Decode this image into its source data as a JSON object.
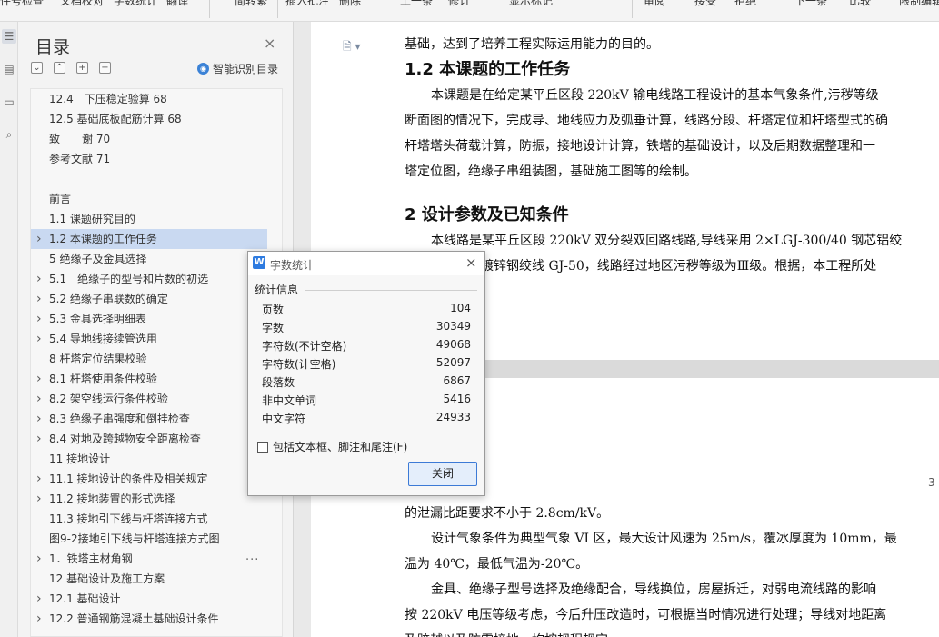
{
  "ribbon": {
    "items": [
      "件号检查",
      "文档校对",
      "字数统计",
      "翻译",
      "简转繁",
      "插入批注",
      "删除",
      "上一条",
      "修订",
      "显示标记",
      "审阅",
      "接受",
      "拒绝",
      "下一条",
      "比较",
      "限制编辑"
    ]
  },
  "sidebar_icons": [
    "toc-icon",
    "pages-icon",
    "bookmark-icon",
    "find-icon"
  ],
  "toc": {
    "title": "目录",
    "close": "×",
    "tools": [
      "⌄",
      "⌃",
      "+",
      "−"
    ],
    "smart_label": "智能识别目录",
    "items": [
      {
        "label": "12.4　下压稳定验算 68",
        "arrow": false,
        "indent": 1
      },
      {
        "label": "12.5 基础底板配筋计算 68",
        "arrow": false,
        "indent": 1
      },
      {
        "label": "致　　谢 70",
        "arrow": false,
        "indent": 1
      },
      {
        "label": "参考文献 71",
        "arrow": false,
        "indent": 1
      },
      {
        "label": "",
        "arrow": false,
        "indent": 1
      },
      {
        "label": "前言",
        "arrow": false,
        "indent": 1
      },
      {
        "label": "1.1  课题研究目的",
        "arrow": false,
        "indent": 1
      },
      {
        "label": "1.2  本课题的工作任务",
        "arrow": true,
        "indent": 1,
        "selected": true
      },
      {
        "label": "5 绝缘子及金具选择",
        "arrow": false,
        "indent": 1
      },
      {
        "label": "5.1　绝缘子的型号和片数的初选",
        "arrow": true,
        "indent": 1
      },
      {
        "label": "5.2 绝缘子串联数的确定",
        "arrow": true,
        "indent": 1
      },
      {
        "label": "5.3 金具选择明细表",
        "arrow": true,
        "indent": 1
      },
      {
        "label": "5.4 导地线接续管选用",
        "arrow": true,
        "indent": 1
      },
      {
        "label": "8 杆塔定位结果校验",
        "arrow": false,
        "indent": 1
      },
      {
        "label": "8.1 杆塔使用条件校验",
        "arrow": true,
        "indent": 1
      },
      {
        "label": "8.2 架空线运行条件校验",
        "arrow": true,
        "indent": 1
      },
      {
        "label": "8.3 绝缘子串强度和倒挂检查",
        "arrow": true,
        "indent": 1
      },
      {
        "label": "8.4 对地及跨越物安全距离检查",
        "arrow": true,
        "indent": 1
      },
      {
        "label": "11 接地设计",
        "arrow": false,
        "indent": 1
      },
      {
        "label": "11.1 接地设计的条件及相关规定",
        "arrow": true,
        "indent": 1
      },
      {
        "label": "11.2 接地装置的形式选择",
        "arrow": true,
        "indent": 1
      },
      {
        "label": "11.3 接地引下线与杆塔连接方式",
        "arrow": false,
        "indent": 1
      },
      {
        "label": "图9-2接地引下线与杆塔连接方式图",
        "arrow": false,
        "indent": 1
      },
      {
        "label": "1．铁塔主材角钢",
        "arrow": true,
        "indent": 1
      },
      {
        "label": "12 基础设计及施工方案",
        "arrow": false,
        "indent": 1
      },
      {
        "label": "12.1 基础设计",
        "arrow": true,
        "indent": 1
      },
      {
        "label": "12.2  普通钢筋混凝土基础设计条件",
        "arrow": true,
        "indent": 1
      }
    ],
    "more": "..."
  },
  "document": {
    "page1_lines": [
      {
        "type": "text",
        "text": "基础，达到了培养工程实际运用能力的目的。"
      },
      {
        "type": "heading",
        "text": "1.2  本课题的工作任务"
      },
      {
        "type": "text",
        "text": "本课题是在给定某平丘区段 220kV 输电线路工程设计的基本气象条件,污秽等级"
      },
      {
        "type": "text",
        "text": "断面图的情况下，完成导、地线应力及弧垂计算，线路分段、杆塔定位和杆塔型式的确"
      },
      {
        "type": "text",
        "text": "杆塔塔头荷载计算，防振，接地设计计算，铁塔的基础设计，以及后期数据整理和一"
      },
      {
        "type": "text",
        "text": "塔定位图，绝缘子串组装图，基础施工图等的绘制。"
      },
      {
        "type": "heading",
        "text": "2   设计参数及已知条件"
      },
      {
        "type": "text",
        "text": "本线路是某平丘区段 220kV 双分裂双回路线路,导线采用 2×LGJ-300/40 钢芯铝绞"
      },
      {
        "type": "text",
        "text": "选配地线采用镀锌钢绞线 GJ-50，线路经过地区污秽等级为Ⅲ级。根据，本工程所处"
      }
    ],
    "page_number": "3",
    "page2_lines": [
      "的泄漏比距要求不小于 2.8cm/kV。",
      "设计气象条件为典型气象 VI 区，最大设计风速为 25m/s，覆冰厚度为 10mm，最",
      "温为 40℃，最低气温为-20℃。",
      "金具、绝缘子型号选择及绝缘配合，导线换位，房屋拆迁，对弱电流线路的影响",
      "按 220kV 电压等级考虑，今后升压改造时，可根据当时情况进行处理；导线对地距离",
      "及跨越以及防雷接地，均按规程规定。"
    ]
  },
  "dialog": {
    "title": "字数统计",
    "close": "×",
    "section_label": "统计信息",
    "stats": [
      {
        "label": "页数",
        "value": "104"
      },
      {
        "label": "字数",
        "value": "30349"
      },
      {
        "label": "字符数(不计空格)",
        "value": "49068"
      },
      {
        "label": "字符数(计空格)",
        "value": "52097"
      },
      {
        "label": "段落数",
        "value": "6867"
      },
      {
        "label": "非中文单词",
        "value": "5416"
      },
      {
        "label": "中文字符",
        "value": "24933"
      }
    ],
    "checkbox_label": "包括文本框、脚注和尾注(F)",
    "checkbox_checked": false,
    "close_button": "关闭"
  }
}
